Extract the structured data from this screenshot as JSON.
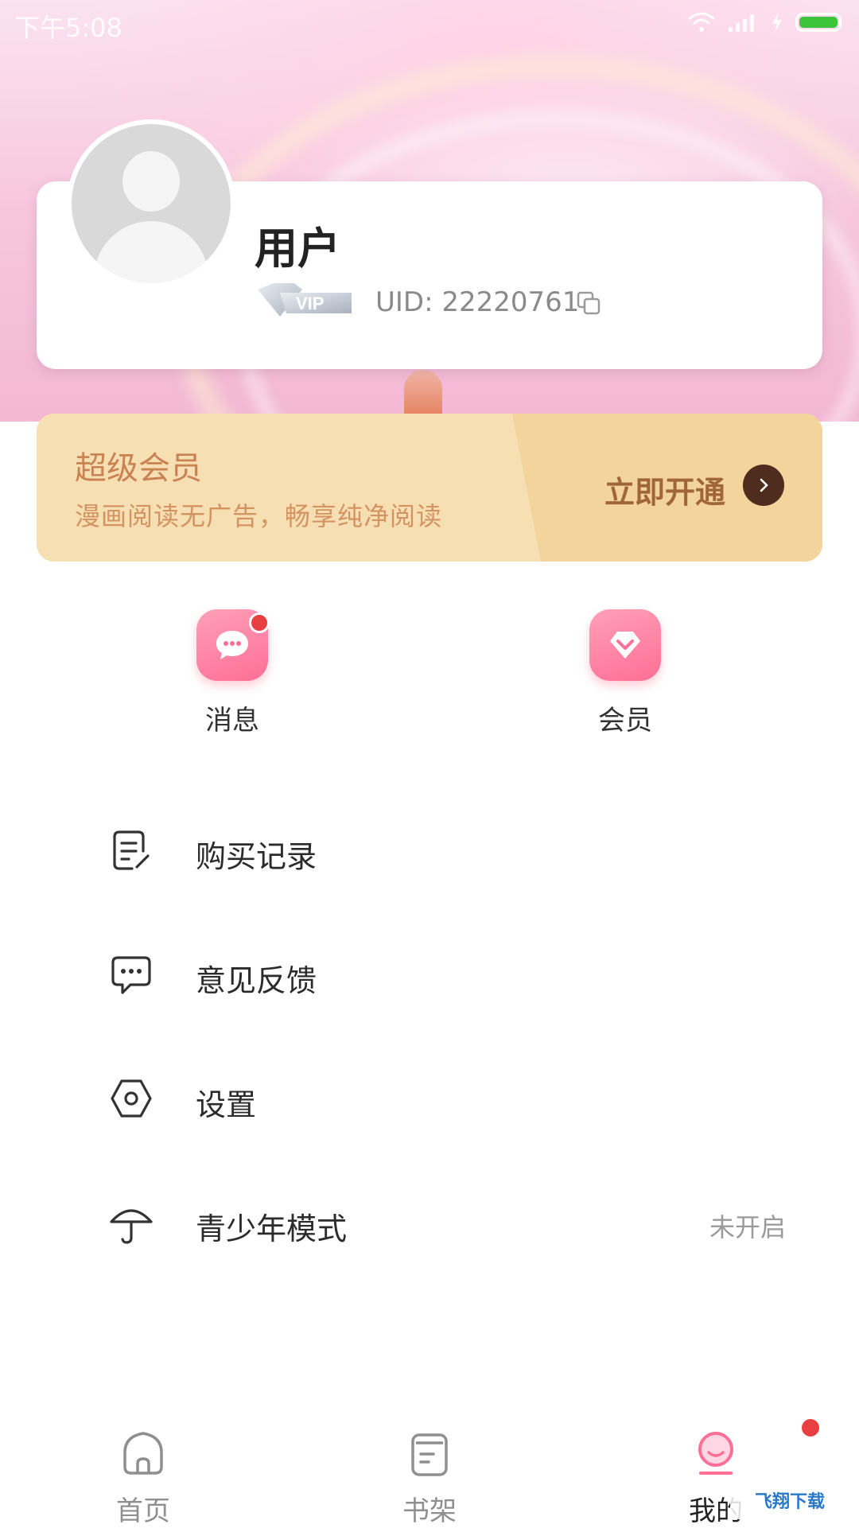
{
  "status_bar": {
    "time": "下午5:08"
  },
  "profile": {
    "username": "用户",
    "uid": "UID: 22220761",
    "vip_badge_text": "VIP"
  },
  "vip_banner": {
    "title": "超级会员",
    "subtitle": "漫画阅读无广告，畅享纯净阅读",
    "cta": "立即开通"
  },
  "quick_actions": [
    {
      "label": "消息",
      "icon": "message-icon",
      "badge": true
    },
    {
      "label": "会员",
      "icon": "diamond-icon",
      "badge": false
    }
  ],
  "menu": [
    {
      "label": "购买记录",
      "icon": "purchase-record-icon",
      "value": ""
    },
    {
      "label": "意见反馈",
      "icon": "feedback-icon",
      "value": ""
    },
    {
      "label": "设置",
      "icon": "settings-icon",
      "value": ""
    },
    {
      "label": "青少年模式",
      "icon": "umbrella-icon",
      "value": "未开启"
    }
  ],
  "tabs": [
    {
      "label": "首页",
      "icon": "home-icon",
      "active": false
    },
    {
      "label": "书架",
      "icon": "bookshelf-icon",
      "active": false
    },
    {
      "label": "我的",
      "icon": "profile-icon",
      "active": true
    }
  ],
  "watermark": "飞翔下载",
  "colors": {
    "accent_pink": "#ff6f96",
    "vip_gold": "#c98352",
    "badge_red": "#e84040"
  }
}
